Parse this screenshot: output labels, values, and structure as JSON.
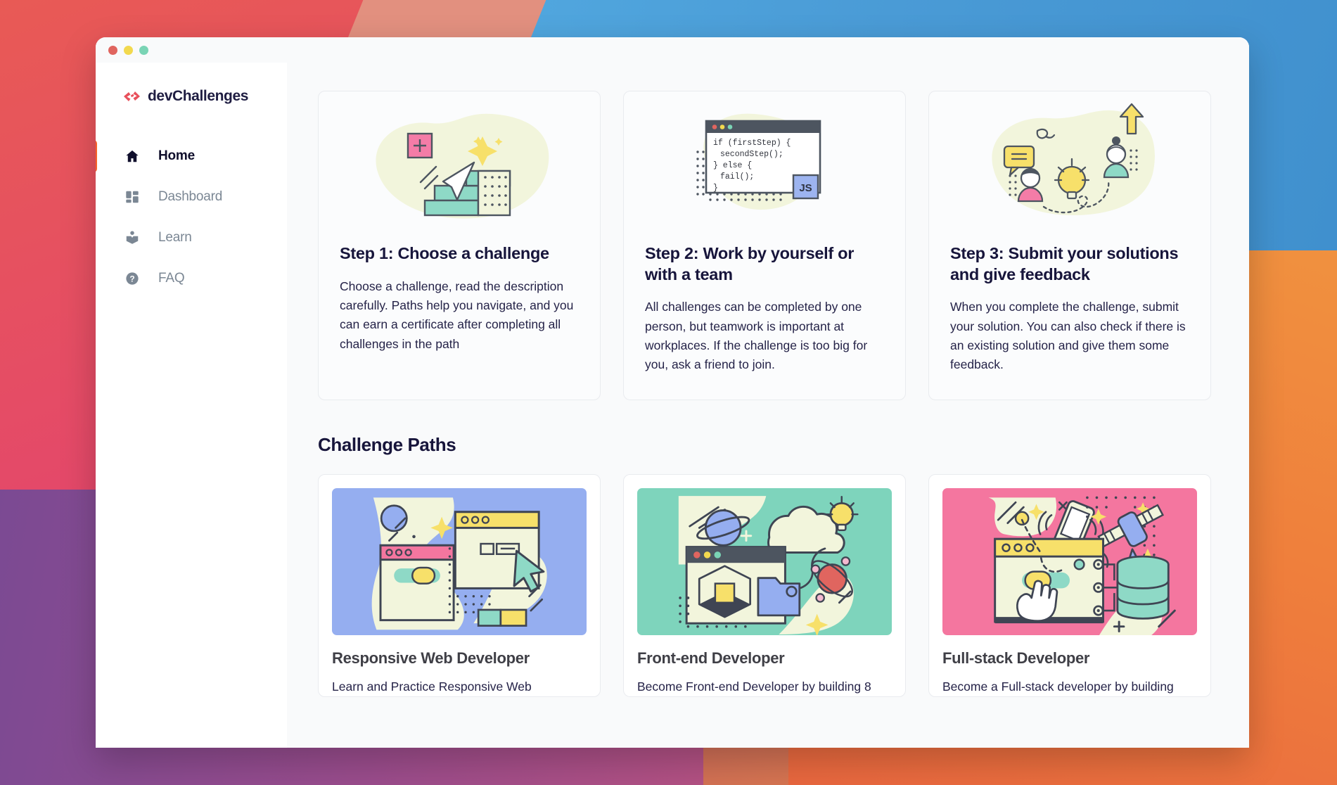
{
  "window": {
    "traffic_lights": [
      {
        "name": "close",
        "color": "#e0655f"
      },
      {
        "name": "minimize",
        "color": "#f2d94e"
      },
      {
        "name": "maximize",
        "color": "#7ad4b5"
      }
    ]
  },
  "sidebar": {
    "brand": "devChallenges",
    "brand_logo_icon": "code-brackets-icon",
    "active_indicator_color": "#f8622a",
    "items": [
      {
        "label": "Home",
        "icon": "home-icon",
        "active": true
      },
      {
        "label": "Dashboard",
        "icon": "dashboard-grid-icon",
        "active": false
      },
      {
        "label": "Learn",
        "icon": "book-open-icon",
        "active": false
      },
      {
        "label": "FAQ",
        "icon": "question-circle-icon",
        "active": false
      }
    ]
  },
  "steps": [
    {
      "title": "Step 1: Choose a challenge",
      "description": "Choose a challenge, read the description carefully. Paths help you navigate, and you can earn a certificate after completing all challenges in the path",
      "illustration": "stairs-cursor-illustration"
    },
    {
      "title": "Step 2: Work by yourself or with a team",
      "description": "All challenges can be completed by one person, but teamwork is important at workplaces. If the challenge is too big for you, ask a friend to join.",
      "illustration": "code-window-illustration",
      "code_lines": [
        "if (firstStep) {",
        "  secondStep();",
        "} else {",
        "  fail();",
        "}"
      ],
      "badge": "JS"
    },
    {
      "title": "Step 3: Submit your solutions and give feedback",
      "description": "When you complete the challenge, submit your solution. You can also check if there is an existing solution and give them some feedback.",
      "illustration": "collaboration-idea-illustration"
    }
  ],
  "challenge_paths": {
    "heading": "Challenge Paths",
    "cards": [
      {
        "title": "Responsive Web Developer",
        "description": "Learn and Practice Responsive Web",
        "thumbnail": "responsive-web-thumbnail",
        "thumb_bg": "#95aef0"
      },
      {
        "title": "Front-end Developer",
        "description": "Become Front-end Developer by building 8",
        "thumbnail": "front-end-thumbnail",
        "thumb_bg": "#7ed4bc"
      },
      {
        "title": "Full-stack Developer",
        "description": "Become a Full-stack developer by building",
        "thumbnail": "full-stack-thumbnail",
        "thumb_bg": "#f4769f"
      }
    ]
  }
}
